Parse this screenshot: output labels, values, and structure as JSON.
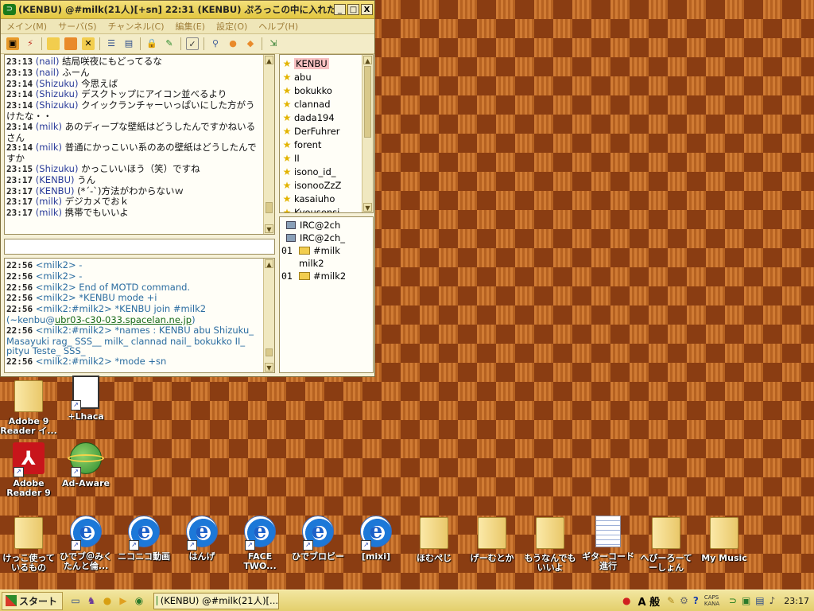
{
  "window": {
    "title": "(KENBU) @#milk(21人)[+sn] 22:31 (KENBU) ぷろっこの中に入れた…",
    "min_label": "_",
    "max_label": "□",
    "close_label": "X"
  },
  "menu": [
    "メイン(M)",
    "サーバ(S)",
    "チャンネル(C)",
    "編集(E)",
    "設定(O)",
    "ヘルプ(H)"
  ],
  "toolbar_icons": [
    "server-icon",
    "connect-icon",
    "channel-folder-icon",
    "open-icon",
    "folder-icon",
    "list-icon",
    "monitor-icon",
    "lock-icon",
    "edit-icon",
    "check-icon",
    "search-icon",
    "balloon-icon",
    "balloon2-icon",
    "export-icon"
  ],
  "channel_log": [
    {
      "time": "23:13",
      "nick": "(nail)",
      "text": "結局咲夜にもどってるな"
    },
    {
      "time": "23:13",
      "nick": "(nail)",
      "text": "ふーん"
    },
    {
      "time": "23:14",
      "nick": "(Shizuku)",
      "text": "今思えば"
    },
    {
      "time": "23:14",
      "nick": "(Shizuku)",
      "text": "デスクトップにアイコン並べるより"
    },
    {
      "time": "23:14",
      "nick": "(Shizuku)",
      "text": "クイックランチャーいっぱいにした方がうけたな・・"
    },
    {
      "time": "23:14",
      "nick": "(milk)",
      "text": "あのディープな壁紙はどうしたんですかねいるさん"
    },
    {
      "time": "23:14",
      "nick": "(milk)",
      "text": "普通にかっこいい系のあの壁紙はどうしたんですか"
    },
    {
      "time": "23:15",
      "nick": "(Shizuku)",
      "text": "かっこいいほう（笑）ですね"
    },
    {
      "time": "23:17",
      "nick": "(KENBU)",
      "text": "うん"
    },
    {
      "time": "23:17",
      "nick": "(KENBU)",
      "text": "(*´-`)方法がわからないｗ"
    },
    {
      "time": "23:17",
      "nick": "(milk)",
      "text": "デジカメでおｋ"
    },
    {
      "time": "23:17",
      "nick": "(milk)",
      "text": "携帯でもいいよ"
    }
  ],
  "server_log": [
    {
      "time": "22:56",
      "text": "<milk2> -"
    },
    {
      "time": "22:56",
      "text": "<milk2> -"
    },
    {
      "time": "22:56",
      "text": "<milk2> End of MOTD command."
    },
    {
      "time": "22:56",
      "text": "<milk2> *KENBU mode +i"
    },
    {
      "time": "22:56",
      "prefix": "<milk2:#milk2> *KENBU join #milk2 (~kenbu@",
      "link": "ubr03-c30-033.spacelan.ne.jp",
      "suffix": ")"
    },
    {
      "time": "22:56",
      "text": "<milk2:#milk2> *names : KENBU abu Shizuku_ Masayuki rag_ SSS__ milk_ clannad nail_ bokukko II_ pityu Teste_ SSS_"
    },
    {
      "time": "22:56",
      "text": "<milk2:#milk2> *mode +sn"
    }
  ],
  "users": [
    "KENBU",
    "abu",
    "bokukko",
    "clannad",
    "dada194",
    "DerFuhrer",
    "forent",
    "II",
    "isono_id_",
    "isonooZzZ",
    "kasaiuho",
    "Kyousensi"
  ],
  "selected_user": "KENBU",
  "tree": [
    {
      "num": "",
      "type": "server",
      "label": "IRC@2ch"
    },
    {
      "num": "",
      "type": "server",
      "label": "IRC@2ch_"
    },
    {
      "num": "01",
      "type": "channel",
      "label": "#milk"
    },
    {
      "num": "",
      "type": "server",
      "label": "milk2"
    },
    {
      "num": "01",
      "type": "channel",
      "label": "#milk2"
    }
  ],
  "desktop_icons": [
    {
      "name": "adobe9-reader-installer",
      "label": "Adobe 9 Reader イ...",
      "kind": "folder"
    },
    {
      "name": "lhaca",
      "label": "+Lhaca",
      "kind": "doc"
    },
    {
      "name": "adobe-reader-9",
      "label": "Adobe Reader 9",
      "kind": "pdf"
    },
    {
      "name": "ad-aware",
      "label": "Ad-Aware",
      "kind": "globe"
    },
    {
      "name": "kekkou-tsukatte",
      "label": "けっこ使っているもの",
      "kind": "folder"
    },
    {
      "name": "hidebu-mikutan",
      "label": "ひでブ＠みくたんと倫...",
      "kind": "ie"
    },
    {
      "name": "nicovideo",
      "label": "ニコニコ動画",
      "kind": "ie"
    },
    {
      "name": "hange",
      "label": "はんげ",
      "kind": "ie"
    },
    {
      "name": "face-two",
      "label": "FACE TWO...",
      "kind": "ie"
    },
    {
      "name": "hidebu-lobby",
      "label": "ひでブロビー",
      "kind": "ie"
    },
    {
      "name": "mixi",
      "label": "[mixi]",
      "kind": "ie"
    },
    {
      "name": "homupeji",
      "label": "ほむぺじ",
      "kind": "folder"
    },
    {
      "name": "game-toka",
      "label": "げーむとか",
      "kind": "folder"
    },
    {
      "name": "mou-nandemo",
      "label": "もうなんでもいいよ",
      "kind": "folder"
    },
    {
      "name": "guitar-code",
      "label": "ギターコード進行",
      "kind": "doc"
    },
    {
      "name": "hebirorote",
      "label": "へびーろーてーしょん",
      "kind": "folder"
    },
    {
      "name": "my-music",
      "label": "My Music",
      "kind": "folder"
    }
  ],
  "taskbar": {
    "start_label": "スタート",
    "task_label": "(KENBU) @#milk(21人)[...",
    "ime_label": "A 般",
    "caps_label": "CAPS KANA",
    "clock": "23:17"
  }
}
